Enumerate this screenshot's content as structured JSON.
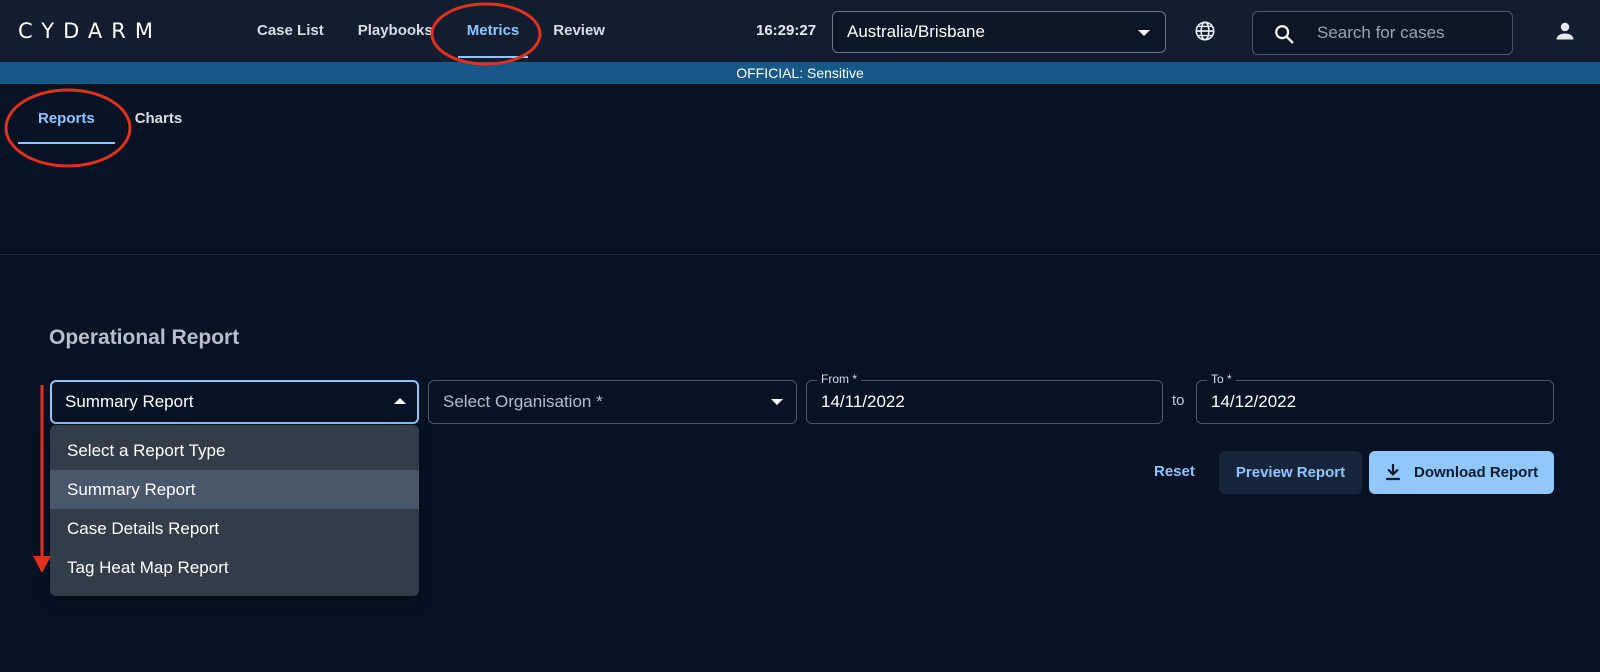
{
  "header": {
    "logo": "CYDARM",
    "nav": [
      {
        "label": "Case List",
        "active": false
      },
      {
        "label": "Playbooks",
        "active": false
      },
      {
        "label": "Metrics",
        "active": true
      },
      {
        "label": "Review",
        "active": false
      }
    ],
    "clock": "16:29:27",
    "timezone": "Australia/Brisbane",
    "search_placeholder": "Search for cases",
    "icons": [
      "globe-icon",
      "search-icon",
      "user-icon",
      "chevron-down-icon"
    ]
  },
  "banner": "OFFICIAL: Sensitive",
  "tabs": [
    {
      "label": "Reports",
      "active": true
    },
    {
      "label": "Charts",
      "active": false
    }
  ],
  "report": {
    "title": "Operational Report",
    "report_type": "Summary Report",
    "organisation_placeholder": "Select Organisation *",
    "from_label": "From *",
    "from_value": "14/11/2022",
    "to_text": "to",
    "to_label": "To *",
    "to_value": "14/12/2022",
    "menu_items": [
      {
        "label": "Select a Report Type",
        "selected": false
      },
      {
        "label": "Summary Report",
        "selected": true
      },
      {
        "label": "Case Details Report",
        "selected": false
      },
      {
        "label": "Tag Heat Map Report",
        "selected": false
      }
    ],
    "buttons": {
      "reset": "Reset",
      "preview": "Preview Report",
      "download": "Download Report"
    }
  },
  "colors": {
    "background": "#071325",
    "topbar": "#121d30",
    "banner": "#165887",
    "accent": "#8fc6ff",
    "annotation": "#e0301e"
  }
}
